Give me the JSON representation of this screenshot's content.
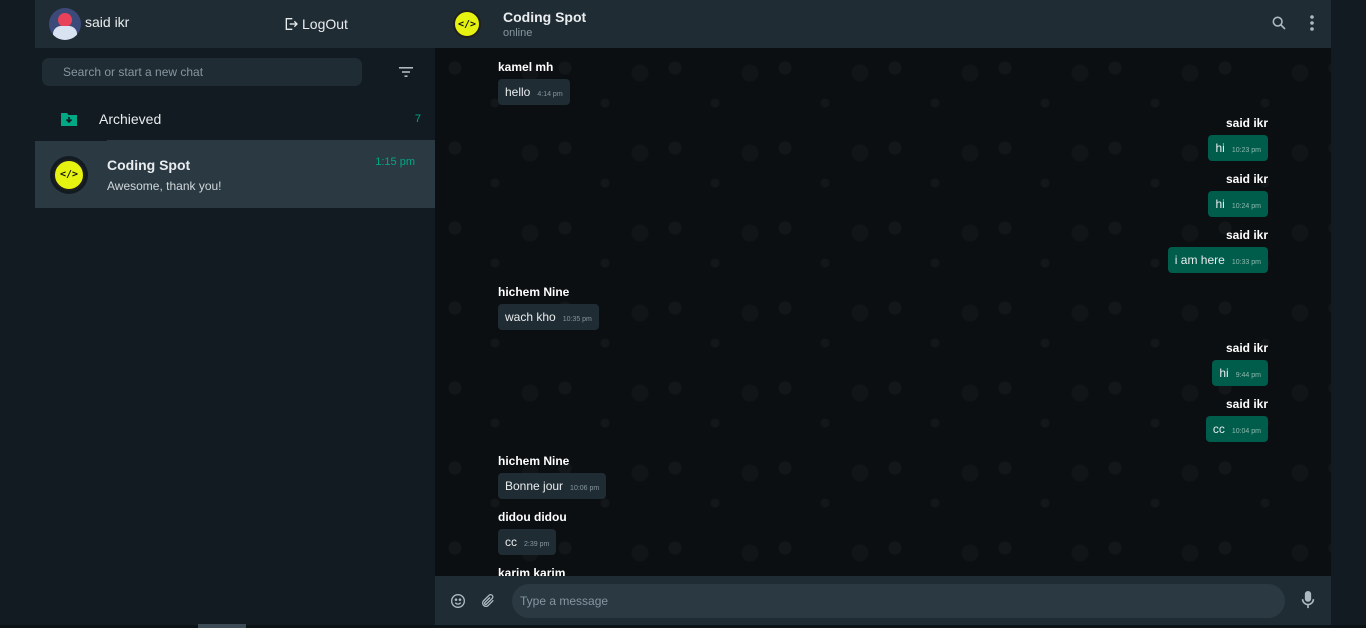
{
  "user": {
    "name": "said ikr"
  },
  "logout": {
    "label": "LogOut"
  },
  "search": {
    "placeholder": "Search or start a new chat"
  },
  "archived": {
    "label": "Archieved",
    "count": "7"
  },
  "chat_list": [
    {
      "title": "Coding Spot",
      "preview": "Awesome, thank you!",
      "time": "1:15 pm",
      "avatar_glyph": "</>"
    }
  ],
  "conversation": {
    "title": "Coding Spot",
    "status": "online",
    "avatar_glyph": "</>"
  },
  "messages": [
    {
      "sender": "kamel mh",
      "text": "hello",
      "time": "4:14 pm",
      "direction": "in"
    },
    {
      "sender": "said ikr",
      "text": "hi",
      "time": "10:23 pm",
      "direction": "out"
    },
    {
      "sender": "said ikr",
      "text": "hi",
      "time": "10:24 pm",
      "direction": "out"
    },
    {
      "sender": "said ikr",
      "text": "i am here",
      "time": "10:33 pm",
      "direction": "out"
    },
    {
      "sender": "hichem Nine",
      "text": "wach kho",
      "time": "10:35 pm",
      "direction": "in"
    },
    {
      "sender": "said ikr",
      "text": "hi",
      "time": "9:44 pm",
      "direction": "out"
    },
    {
      "sender": "said ikr",
      "text": "cc",
      "time": "10:04 pm",
      "direction": "out"
    },
    {
      "sender": "hichem Nine",
      "text": "Bonne jour",
      "time": "10:06 pm",
      "direction": "in"
    },
    {
      "sender": "didou didou",
      "text": "cc",
      "time": "2:39 pm",
      "direction": "in"
    },
    {
      "sender": "karim karim",
      "text": "",
      "time": "",
      "direction": "in"
    }
  ],
  "composer": {
    "placeholder": "Type a message"
  },
  "icons": {
    "logout": "logout-icon",
    "filter": "filter-icon",
    "archive": "archive-icon",
    "search": "search-icon",
    "menu": "more-vertical-icon",
    "emoji": "emoji-icon",
    "attach": "attach-icon",
    "mic": "mic-icon"
  },
  "colors": {
    "accent": "#00a884",
    "outgoing_bubble": "#005c4b",
    "incoming_bubble": "#202c33",
    "panel": "#202c33",
    "group_avatar": "#e6f20f"
  }
}
